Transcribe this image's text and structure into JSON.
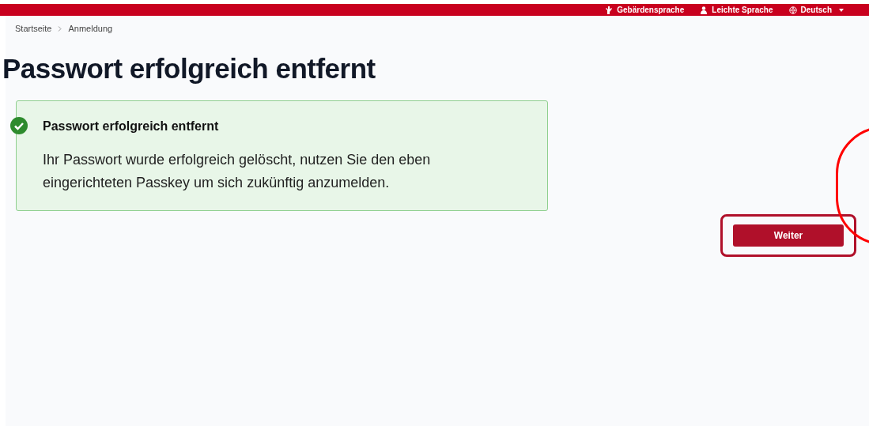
{
  "top_bar": {
    "items": [
      {
        "kind": "sign",
        "label": "Gebärdensprache"
      },
      {
        "kind": "easy",
        "label": "Leichte Sprache"
      },
      {
        "kind": "language",
        "label": "Deutsch"
      }
    ]
  },
  "breadcrumb": [
    "Startseite",
    "Anmeldung"
  ],
  "title": "Passwort erfolgreich entfernt",
  "alert": {
    "title": "Passwort erfolgreich entfernt",
    "text": "Ihr Passwort wurde erfolgreich gelöscht, nutzen Sie den eben eingerichteten Passkey um sich zukünftig anzumelden."
  },
  "button": "Weiter"
}
